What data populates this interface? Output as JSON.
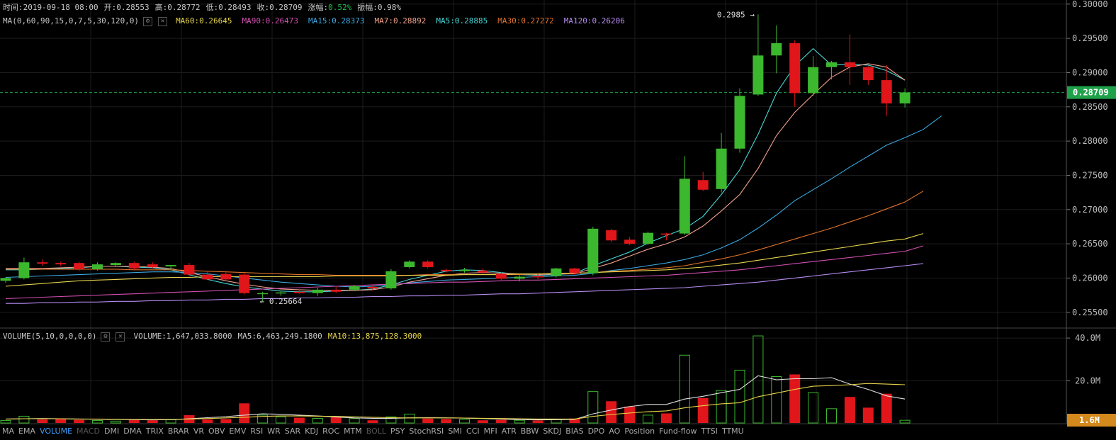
{
  "header": {
    "time_label": "时间:2019-09-18 08:00",
    "open_label": "开:0.28553",
    "high_label": "高:0.28772",
    "low_label": "低:0.28493",
    "close_label": "收:0.28709",
    "change_prefix": "涨幅:",
    "change_value": "0.52%",
    "amplitude_label": "振幅:0.98%"
  },
  "ma_legend": {
    "params": "MA(0,60,90,15,0,7,5,30,120,0)",
    "items": [
      {
        "text": "MA60:0.26645",
        "color": "#e6d34a"
      },
      {
        "text": "MA90:0.26473",
        "color": "#d04fb0"
      },
      {
        "text": "MA15:0.28373",
        "color": "#3aa7e0"
      },
      {
        "text": "MA7:0.28892",
        "color": "#f0a08a"
      },
      {
        "text": "MA5:0.28885",
        "color": "#49d6d6"
      },
      {
        "text": "MA30:0.27272",
        "color": "#e0732a"
      },
      {
        "text": "MA120:0.26206",
        "color": "#b58af0"
      }
    ]
  },
  "volume_legend": {
    "params": "VOLUME(5,10,0,0,0,0)",
    "volume": "VOLUME:1,647,033.8000",
    "ma5": "MA5:6,463,249.1800",
    "ma10": "MA10:13,875,128.3000",
    "ma10_color": "#e6d34a"
  },
  "toolbar": {
    "items": [
      "MA",
      "EMA",
      "VOLUME",
      "MACD",
      "DMI",
      "DMA",
      "TRIX",
      "BRAR",
      "VR",
      "OBV",
      "EMV",
      "RSI",
      "WR",
      "SAR",
      "KDJ",
      "ROC",
      "MTM",
      "BOLL",
      "PSY",
      "StochRSI",
      "SMI",
      "CCI",
      "MFI",
      "ATR",
      "BBW",
      "SKDJ",
      "BIAS",
      "DPO",
      "AO",
      "Position",
      "Fund-flow",
      "TTSI",
      "TTMU"
    ],
    "active": "VOLUME",
    "disabled": [
      "MACD",
      "BOLL"
    ]
  },
  "chart_data": {
    "type": "candlestick",
    "price_axis": {
      "ticks": [
        "0.30000",
        "0.29500",
        "0.29000",
        "0.28500",
        "0.28000",
        "0.27500",
        "0.27000",
        "0.26500",
        "0.26000",
        "0.25500"
      ],
      "range": [
        0.2527,
        0.3006
      ],
      "last_price": "0.28709",
      "last_price_color": "#1fa14a"
    },
    "volume_axis": {
      "ticks": [
        "40.0M",
        "20.0M"
      ],
      "tick_values": [
        40000000,
        20000000
      ],
      "range": [
        0,
        44000000
      ],
      "current_label": "1.6M",
      "current_value": 1647033.8,
      "current_color": "#d4891d"
    },
    "annotations": {
      "max_label": "0.2985 →",
      "max_price": 0.2985,
      "max_index": 41,
      "min_label": "← 0.25664",
      "min_price": 0.25664,
      "min_index": 14
    },
    "candles": [
      {
        "o": 0.2596,
        "h": 0.2601,
        "l": 0.2593,
        "c": 0.26,
        "v": 1.5
      },
      {
        "o": 0.26,
        "h": 0.263,
        "l": 0.2598,
        "c": 0.2623,
        "v": 3.5
      },
      {
        "o": 0.2623,
        "h": 0.2627,
        "l": 0.2618,
        "c": 0.2621,
        "v": 2.0
      },
      {
        "o": 0.2622,
        "h": 0.2624,
        "l": 0.2618,
        "c": 0.262,
        "v": 2.2
      },
      {
        "o": 0.2622,
        "h": 0.2624,
        "l": 0.261,
        "c": 0.2613,
        "v": 1.8
      },
      {
        "o": 0.2613,
        "h": 0.2623,
        "l": 0.2611,
        "c": 0.262,
        "v": 1.5
      },
      {
        "o": 0.2619,
        "h": 0.2623,
        "l": 0.2616,
        "c": 0.2622,
        "v": 1.2
      },
      {
        "o": 0.2622,
        "h": 0.2624,
        "l": 0.2612,
        "c": 0.2614,
        "v": 2.0
      },
      {
        "o": 0.262,
        "h": 0.2623,
        "l": 0.2614,
        "c": 0.2616,
        "v": 1.6
      },
      {
        "o": 0.2617,
        "h": 0.2619,
        "l": 0.2612,
        "c": 0.2619,
        "v": 1.8
      },
      {
        "o": 0.2619,
        "h": 0.2622,
        "l": 0.2602,
        "c": 0.2605,
        "v": 4.0
      },
      {
        "o": 0.2605,
        "h": 0.261,
        "l": 0.2599,
        "c": 0.2598,
        "v": 2.0
      },
      {
        "o": 0.2606,
        "h": 0.2608,
        "l": 0.2596,
        "c": 0.2598,
        "v": 2.2
      },
      {
        "o": 0.2605,
        "h": 0.2607,
        "l": 0.2576,
        "c": 0.2578,
        "v": 9.5
      },
      {
        "o": 0.2577,
        "h": 0.258,
        "l": 0.2566,
        "c": 0.2578,
        "v": 4.0
      },
      {
        "o": 0.2578,
        "h": 0.2582,
        "l": 0.2574,
        "c": 0.2579,
        "v": 3.2
      },
      {
        "o": 0.258,
        "h": 0.2584,
        "l": 0.2577,
        "c": 0.2578,
        "v": 2.8
      },
      {
        "o": 0.2578,
        "h": 0.2586,
        "l": 0.2574,
        "c": 0.2583,
        "v": 2.5
      },
      {
        "o": 0.2583,
        "h": 0.2588,
        "l": 0.2578,
        "c": 0.258,
        "v": 3.0
      },
      {
        "o": 0.2583,
        "h": 0.259,
        "l": 0.2581,
        "c": 0.2588,
        "v": 2.4
      },
      {
        "o": 0.2587,
        "h": 0.259,
        "l": 0.2582,
        "c": 0.2585,
        "v": 1.6
      },
      {
        "o": 0.2585,
        "h": 0.2613,
        "l": 0.2583,
        "c": 0.261,
        "v": 3.2
      },
      {
        "o": 0.2616,
        "h": 0.2626,
        "l": 0.2614,
        "c": 0.2624,
        "v": 4.5
      },
      {
        "o": 0.2624,
        "h": 0.2626,
        "l": 0.2614,
        "c": 0.2616,
        "v": 2.4
      },
      {
        "o": 0.2612,
        "h": 0.2614,
        "l": 0.2608,
        "c": 0.261,
        "v": 2.2
      },
      {
        "o": 0.261,
        "h": 0.2615,
        "l": 0.2608,
        "c": 0.2612,
        "v": 2.0
      },
      {
        "o": 0.2611,
        "h": 0.2614,
        "l": 0.2606,
        "c": 0.2608,
        "v": 1.6
      },
      {
        "o": 0.2606,
        "h": 0.2609,
        "l": 0.2597,
        "c": 0.2599,
        "v": 1.8
      },
      {
        "o": 0.2599,
        "h": 0.2604,
        "l": 0.2595,
        "c": 0.2602,
        "v": 1.6
      },
      {
        "o": 0.2603,
        "h": 0.2606,
        "l": 0.2598,
        "c": 0.2601,
        "v": 1.5
      },
      {
        "o": 0.2603,
        "h": 0.2615,
        "l": 0.2601,
        "c": 0.2614,
        "v": 2.0
      },
      {
        "o": 0.2614,
        "h": 0.2615,
        "l": 0.2605,
        "c": 0.2607,
        "v": 2.4
      },
      {
        "o": 0.2607,
        "h": 0.2675,
        "l": 0.2604,
        "c": 0.2672,
        "v": 15.0
      },
      {
        "o": 0.267,
        "h": 0.2672,
        "l": 0.2652,
        "c": 0.2655,
        "v": 10.5
      },
      {
        "o": 0.2656,
        "h": 0.266,
        "l": 0.2648,
        "c": 0.265,
        "v": 8.0
      },
      {
        "o": 0.265,
        "h": 0.2668,
        "l": 0.2648,
        "c": 0.2666,
        "v": 4.0
      },
      {
        "o": 0.2665,
        "h": 0.2666,
        "l": 0.2655,
        "c": 0.2664,
        "v": 4.8
      },
      {
        "o": 0.2665,
        "h": 0.2778,
        "l": 0.2663,
        "c": 0.2745,
        "v": 32.0
      },
      {
        "o": 0.2743,
        "h": 0.2755,
        "l": 0.2727,
        "c": 0.2729,
        "v": 12.0
      },
      {
        "o": 0.273,
        "h": 0.2812,
        "l": 0.2725,
        "c": 0.2789,
        "v": 15.5
      },
      {
        "o": 0.2789,
        "h": 0.2877,
        "l": 0.2783,
        "c": 0.2866,
        "v": 25.0
      },
      {
        "o": 0.2868,
        "h": 0.2985,
        "l": 0.2866,
        "c": 0.2925,
        "v": 41.0
      },
      {
        "o": 0.2925,
        "h": 0.2969,
        "l": 0.2899,
        "c": 0.2943,
        "v": 22.0
      },
      {
        "o": 0.2943,
        "h": 0.2947,
        "l": 0.285,
        "c": 0.287,
        "v": 23.0
      },
      {
        "o": 0.287,
        "h": 0.2924,
        "l": 0.2866,
        "c": 0.2908,
        "v": 14.5
      },
      {
        "o": 0.2908,
        "h": 0.2917,
        "l": 0.289,
        "c": 0.2915,
        "v": 7.0
      },
      {
        "o": 0.2915,
        "h": 0.2956,
        "l": 0.2882,
        "c": 0.2908,
        "v": 12.5
      },
      {
        "o": 0.2908,
        "h": 0.291,
        "l": 0.2882,
        "c": 0.2889,
        "v": 7.5
      },
      {
        "o": 0.2889,
        "h": 0.2911,
        "l": 0.2837,
        "c": 0.2855,
        "v": 14.0
      },
      {
        "o": 0.2855,
        "h": 0.2877,
        "l": 0.2849,
        "c": 0.2871,
        "v": 1.6
      }
    ],
    "ma_series": [
      {
        "name": "MA5",
        "color": "#49d6d6",
        "values": [
          0.2612,
          0.2612,
          0.2613,
          0.2614,
          0.2615,
          0.2617,
          0.2617,
          0.2616,
          0.2615,
          0.2612,
          0.2605,
          0.2598,
          0.2592,
          0.2587,
          0.2584,
          0.2581,
          0.258,
          0.258,
          0.2581,
          0.2582,
          0.2584,
          0.259,
          0.2598,
          0.2604,
          0.261,
          0.2612,
          0.2611,
          0.2608,
          0.2605,
          0.2604,
          0.2605,
          0.2607,
          0.2618,
          0.2628,
          0.2638,
          0.2651,
          0.2662,
          0.2672,
          0.269,
          0.2722,
          0.2758,
          0.281,
          0.287,
          0.291,
          0.2935,
          0.2911,
          0.2912,
          0.2911,
          0.2903,
          0.2889
        ]
      },
      {
        "name": "MA7",
        "color": "#f0a08a",
        "values": [
          0.2614,
          0.2614,
          0.2614,
          0.2615,
          0.2616,
          0.2617,
          0.2617,
          0.2617,
          0.2616,
          0.2614,
          0.2608,
          0.2602,
          0.2596,
          0.2591,
          0.2587,
          0.2584,
          0.2583,
          0.2582,
          0.2582,
          0.2582,
          0.2583,
          0.2587,
          0.2594,
          0.2599,
          0.2604,
          0.2607,
          0.2608,
          0.2607,
          0.2606,
          0.2605,
          0.2606,
          0.2606,
          0.2614,
          0.2622,
          0.2632,
          0.2642,
          0.265,
          0.266,
          0.2676,
          0.2698,
          0.2722,
          0.276,
          0.2808,
          0.2842,
          0.2868,
          0.2893,
          0.2908,
          0.2913,
          0.2908,
          0.2889
        ]
      },
      {
        "name": "MA15",
        "color": "#3aa7e0",
        "values": [
          0.2601,
          0.2602,
          0.2603,
          0.2604,
          0.2605,
          0.2606,
          0.2607,
          0.2608,
          0.2609,
          0.2609,
          0.2608,
          0.2606,
          0.2603,
          0.26,
          0.2597,
          0.2594,
          0.2592,
          0.259,
          0.2588,
          0.2587,
          0.2588,
          0.259,
          0.2593,
          0.2595,
          0.2597,
          0.2598,
          0.2599,
          0.26,
          0.2601,
          0.2602,
          0.2603,
          0.2604,
          0.2607,
          0.2611,
          0.2614,
          0.2618,
          0.2622,
          0.2627,
          0.2634,
          0.2644,
          0.2656,
          0.2673,
          0.2692,
          0.2713,
          0.2729,
          0.2745,
          0.2762,
          0.2778,
          0.2794,
          0.2805,
          0.2817,
          0.2837
        ]
      },
      {
        "name": "MA30",
        "color": "#e0732a",
        "values": [
          0.2613,
          0.2613,
          0.2613,
          0.2613,
          0.2613,
          0.2613,
          0.2613,
          0.2612,
          0.2612,
          0.2612,
          0.2611,
          0.261,
          0.2609,
          0.2608,
          0.2607,
          0.2606,
          0.2605,
          0.2605,
          0.2604,
          0.2604,
          0.2604,
          0.2604,
          0.2604,
          0.2605,
          0.2605,
          0.2605,
          0.2605,
          0.2605,
          0.2605,
          0.2606,
          0.2606,
          0.2607,
          0.2608,
          0.261,
          0.2611,
          0.2613,
          0.2615,
          0.2618,
          0.2623,
          0.2628,
          0.2634,
          0.2641,
          0.2649,
          0.2657,
          0.2665,
          0.2673,
          0.2682,
          0.2691,
          0.2701,
          0.2711,
          0.2727
        ]
      },
      {
        "name": "MA60",
        "color": "#e6d34a",
        "values": [
          0.2588,
          0.259,
          0.2592,
          0.2594,
          0.2596,
          0.2597,
          0.2598,
          0.2599,
          0.26,
          0.2601,
          0.2601,
          0.2602,
          0.2602,
          0.2602,
          0.2602,
          0.2602,
          0.2602,
          0.2602,
          0.2603,
          0.2603,
          0.2603,
          0.2603,
          0.2604,
          0.2604,
          0.2604,
          0.2605,
          0.2605,
          0.2605,
          0.2606,
          0.2606,
          0.2607,
          0.2607,
          0.2608,
          0.2609,
          0.261,
          0.2611,
          0.2612,
          0.2614,
          0.2616,
          0.2619,
          0.2622,
          0.2626,
          0.263,
          0.2634,
          0.2638,
          0.2642,
          0.2646,
          0.265,
          0.2654,
          0.2657,
          0.2665
        ]
      },
      {
        "name": "MA90",
        "color": "#d04fb0",
        "values": [
          0.257,
          0.2571,
          0.2572,
          0.2573,
          0.2574,
          0.2575,
          0.2576,
          0.2577,
          0.2578,
          0.2579,
          0.258,
          0.2581,
          0.2582,
          0.2583,
          0.2584,
          0.2585,
          0.2586,
          0.2587,
          0.2588,
          0.2589,
          0.259,
          0.2591,
          0.2592,
          0.2593,
          0.2594,
          0.2594,
          0.2595,
          0.2596,
          0.2597,
          0.2597,
          0.2598,
          0.2599,
          0.26,
          0.2601,
          0.2602,
          0.2603,
          0.2604,
          0.2606,
          0.2608,
          0.261,
          0.2612,
          0.2615,
          0.2618,
          0.2621,
          0.2624,
          0.2627,
          0.263,
          0.2633,
          0.2636,
          0.2639,
          0.2647
        ]
      },
      {
        "name": "MA120",
        "color": "#b58af0",
        "values": [
          0.2563,
          0.2563,
          0.2564,
          0.2564,
          0.2565,
          0.2565,
          0.2566,
          0.2566,
          0.2567,
          0.2567,
          0.2568,
          0.2568,
          0.2569,
          0.2569,
          0.257,
          0.257,
          0.2571,
          0.2571,
          0.2572,
          0.2572,
          0.2573,
          0.2573,
          0.2574,
          0.2574,
          0.2575,
          0.2575,
          0.2576,
          0.2577,
          0.2577,
          0.2578,
          0.2579,
          0.258,
          0.2581,
          0.2582,
          0.2583,
          0.2584,
          0.2585,
          0.2586,
          0.2588,
          0.259,
          0.2592,
          0.2594,
          0.2597,
          0.26,
          0.2603,
          0.2606,
          0.2609,
          0.2612,
          0.2615,
          0.2618,
          0.2621
        ]
      }
    ],
    "vol_ma_series": [
      {
        "name": "MA5",
        "color": "#e0e0e0",
        "values": [
          2.2,
          2.3,
          2.4,
          2.3,
          2.2,
          2.1,
          2.0,
          1.9,
          1.8,
          1.9,
          2.3,
          2.8,
          3.3,
          4.0,
          4.6,
          4.4,
          4.0,
          3.6,
          3.1,
          2.7,
          2.5,
          2.5,
          2.7,
          2.8,
          2.7,
          2.6,
          2.4,
          2.2,
          1.9,
          1.8,
          1.9,
          2.0,
          4.6,
          6.4,
          8.0,
          9.0,
          9.0,
          11.5,
          12.8,
          14.5,
          16.0,
          22.4,
          20.5,
          21.0,
          21.0,
          21.5,
          18.5,
          16.0,
          13.0,
          11.5,
          9.2
        ]
      },
      {
        "name": "MA10",
        "color": "#e6d34a",
        "values": [
          2.2,
          2.3,
          2.3,
          2.3,
          2.2,
          2.2,
          2.1,
          2.0,
          2.0,
          2.0,
          2.2,
          2.4,
          2.7,
          3.0,
          3.4,
          3.6,
          3.6,
          3.5,
          3.4,
          3.2,
          3.0,
          2.8,
          2.7,
          2.7,
          2.7,
          2.6,
          2.5,
          2.4,
          2.3,
          2.2,
          2.2,
          2.2,
          3.4,
          4.3,
          5.0,
          5.6,
          6.0,
          7.4,
          8.4,
          9.3,
          9.8,
          12.6,
          14.3,
          16.0,
          17.5,
          17.8,
          18.2,
          18.8,
          18.5,
          18.2,
          17.6
        ]
      }
    ]
  }
}
